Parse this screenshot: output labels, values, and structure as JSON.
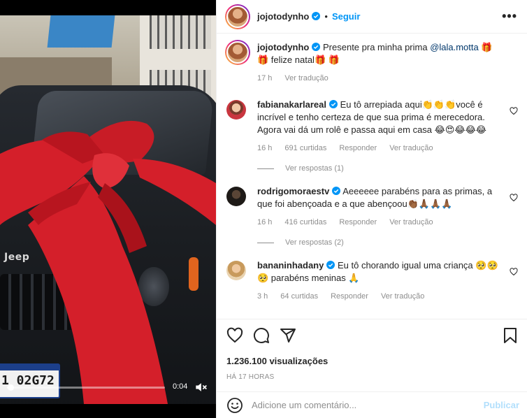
{
  "post": {
    "author": "jojotodynho",
    "follow_label": "Seguir",
    "separator": "•",
    "more_glyph": "•••"
  },
  "video": {
    "brand_text": "Jeep",
    "plate_text": "1 02G72",
    "elapsed": "0:04",
    "progress_fraction": 0.02
  },
  "caption": {
    "user": "jojotodynho",
    "text_before": "Presente pra minha prima ",
    "mention": "@lala.motta",
    "text_after": " 🎁 🎁 felize natal🎁 🎁",
    "time": "17 h",
    "translate": "Ver tradução"
  },
  "comments": [
    {
      "user": "fabianakarlareal",
      "verified": true,
      "text": "Eu tô arrepiada aqui👏👏👏você é incrível e tenho certeza de que sua prima é merecedora. Agora vai dá um rolê e passa aqui em casa 😂😍😂😂😂",
      "time": "16 h",
      "likes": "691 curtidas",
      "reply": "Responder",
      "translate": "Ver tradução",
      "replies": "Ver respostas (1)",
      "avatar_color": "#c9363f"
    },
    {
      "user": "rodrigomoraestv",
      "verified": true,
      "text": "Aeeeeee parabéns para as primas, a que foi abençoada e a que abençoou👏🏾🙏🏾🙏🏾🙏🏾",
      "time": "16 h",
      "likes": "416 curtidas",
      "reply": "Responder",
      "translate": "Ver tradução",
      "replies": "Ver respostas (2)",
      "avatar_color": "#2a2520"
    },
    {
      "user": "bananinhadany",
      "verified": true,
      "text": "Eu tô chorando igual uma criança 🥺🥺 🥺 parabéns meninas 🙏",
      "time": "3 h",
      "likes": "64 curtidas",
      "reply": "Responder",
      "translate": "Ver tradução",
      "avatar_color": "#d9b27a"
    }
  ],
  "stats": {
    "views": "1.236.100 visualizações",
    "time_ago": "HÁ 17 HORAS"
  },
  "composer": {
    "placeholder": "Adicione um comentário...",
    "publish_label": "Publicar"
  },
  "icons": [
    "heart-icon",
    "comment-icon",
    "share-icon",
    "bookmark-icon",
    "emoji-icon",
    "mute-icon",
    "verified-icon",
    "more-icon"
  ],
  "colors": {
    "accent": "#0095f6",
    "publish_disabled": "#b2dffc",
    "ribbon": "#d41f2a",
    "muted_text": "#8e8e8e"
  }
}
